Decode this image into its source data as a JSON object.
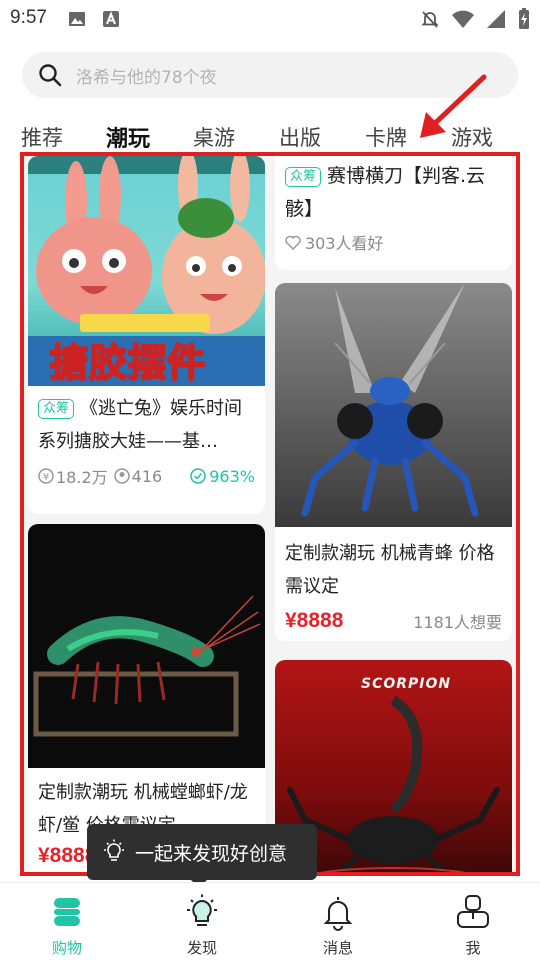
{
  "status_bar": {
    "time": "9:57"
  },
  "search": {
    "placeholder": "洛希与他的78个夜"
  },
  "tabs": [
    {
      "label": "推荐",
      "active": false
    },
    {
      "label": "潮玩",
      "active": true
    },
    {
      "label": "桌游",
      "active": false
    },
    {
      "label": "出版",
      "active": false
    },
    {
      "label": "卡牌",
      "active": false
    },
    {
      "label": "游戏",
      "active": false
    }
  ],
  "feed": {
    "card_rabbit": {
      "image_text": "搪胶摆件",
      "tag": "众筹",
      "title": "《逃亡兔》娱乐时间系列搪胶大娃——基…",
      "raised": "18.2万",
      "backers": "416",
      "percent": "963%"
    },
    "card_knife": {
      "tag": "众筹",
      "title": "赛博横刀【判客.云骸】",
      "watchers": "303人看好"
    },
    "card_wasp": {
      "title": "定制款潮玩 机械青蜂 价格需议定",
      "price": "¥8888",
      "wants": "1181人想要"
    },
    "card_shrimp": {
      "title": "定制款潮玩 机械螳螂虾/龙虾/鲎 价格需议定",
      "price": "¥8888"
    },
    "card_scorpion": {
      "image_text": "SCORPION"
    }
  },
  "toast": {
    "text": "一起来发现好创意"
  },
  "nav": [
    {
      "label": "购物",
      "active": true
    },
    {
      "label": "发现",
      "active": false
    },
    {
      "label": "消息",
      "active": false
    },
    {
      "label": "我",
      "active": false
    }
  ],
  "colors": {
    "accent": "#21c4a6",
    "highlight": "#e02020",
    "price": "#e8242a"
  }
}
